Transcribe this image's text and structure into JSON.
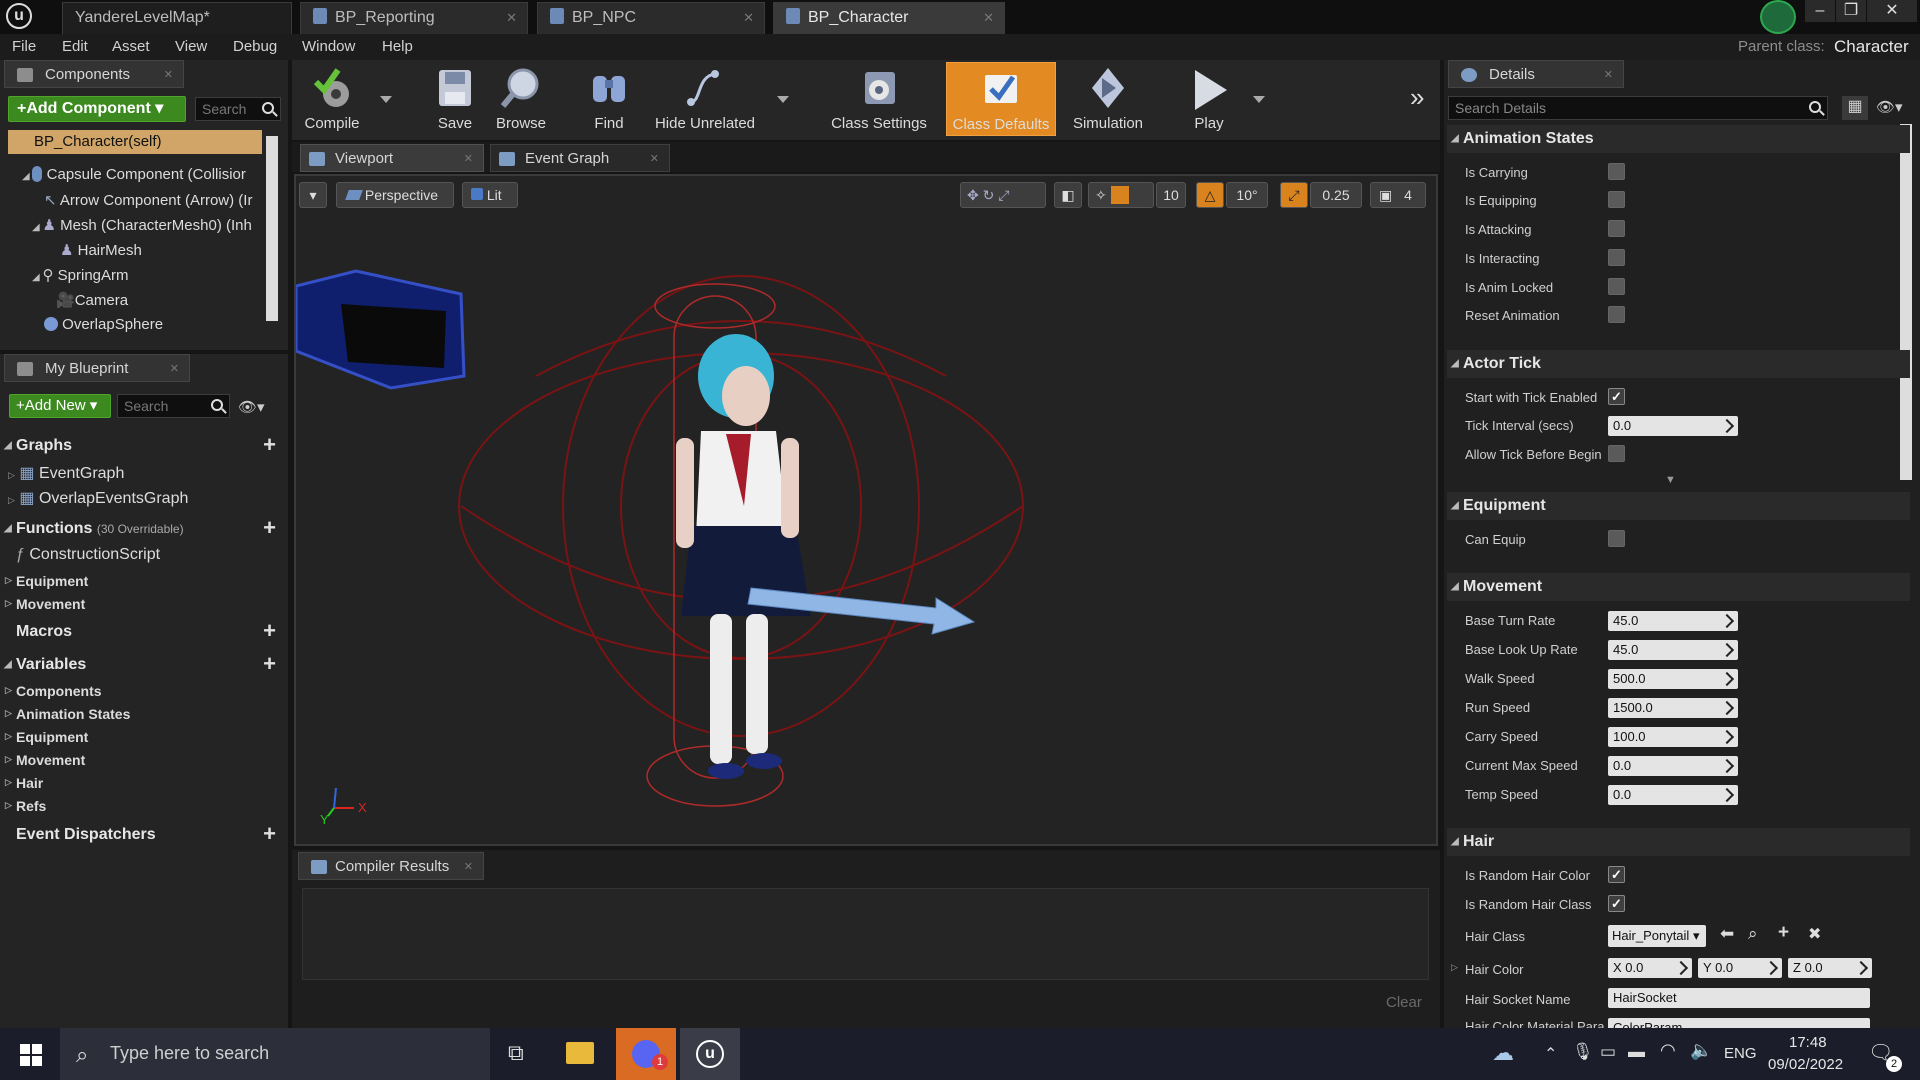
{
  "tabs": [
    {
      "label": "YandereLevelMap*"
    },
    {
      "label": "BP_Reporting"
    },
    {
      "label": "BP_NPC"
    },
    {
      "label": "BP_Character"
    }
  ],
  "menu": [
    "File",
    "Edit",
    "Asset",
    "View",
    "Debug",
    "Window",
    "Help"
  ],
  "parent_class": {
    "label": "Parent class:",
    "value": "Character"
  },
  "components_panel": {
    "title": "Components",
    "add_component": "Add Component",
    "search_placeholder": "Search",
    "self_item": "BP_Character(self)",
    "tree": [
      "Capsule Component (Collisior",
      "Arrow Component (Arrow) (Ir",
      "Mesh (CharacterMesh0) (Inh",
      "HairMesh",
      "SpringArm",
      "Camera",
      "OverlapSphere"
    ]
  },
  "my_blueprint": {
    "title": "My Blueprint",
    "add_new": "Add New",
    "search_placeholder": "Search",
    "graphs_header": "Graphs",
    "graphs": [
      "EventGraph",
      "OverlapEventsGraph"
    ],
    "functions_header": "Functions",
    "functions_note": "(30 Overridable)",
    "functions": [
      "ConstructionScript"
    ],
    "function_categories": [
      "Equipment",
      "Movement"
    ],
    "macros_header": "Macros",
    "variables_header": "Variables",
    "variable_categories": [
      "Components",
      "Animation States",
      "Equipment",
      "Movement",
      "Hair",
      "Refs"
    ],
    "event_dispatchers_header": "Event Dispatchers"
  },
  "toolbar": {
    "compile": "Compile",
    "save": "Save",
    "browse": "Browse",
    "find": "Find",
    "hide_unrelated": "Hide Unrelated",
    "class_settings": "Class Settings",
    "class_defaults": "Class Defaults",
    "simulation": "Simulation",
    "play": "Play"
  },
  "viewport": {
    "tab_viewport": "Viewport",
    "tab_event_graph": "Event Graph",
    "perspective": "Perspective",
    "lit": "Lit",
    "grid_snap": "10",
    "rotation_snap": "10°",
    "scale_snap": "0.25",
    "camera_speed": "4",
    "axis_x": "X",
    "axis_y": "Y"
  },
  "compiler": {
    "title": "Compiler Results",
    "clear": "Clear"
  },
  "details": {
    "title": "Details",
    "search_placeholder": "Search Details",
    "animation_states": {
      "header": "Animation States",
      "items": [
        {
          "label": "Is Carrying",
          "checked": false
        },
        {
          "label": "Is Equipping",
          "checked": false
        },
        {
          "label": "Is Attacking",
          "checked": false
        },
        {
          "label": "Is Interacting",
          "checked": false
        },
        {
          "label": "Is Anim Locked",
          "checked": false
        },
        {
          "label": "Reset Animation",
          "checked": false
        }
      ]
    },
    "actor_tick": {
      "header": "Actor Tick",
      "start_tick_label": "Start with Tick Enabled",
      "tick_interval_label": "Tick Interval (secs)",
      "tick_interval_value": "0.0",
      "allow_tick_label": "Allow Tick Before Begin"
    },
    "equipment": {
      "header": "Equipment",
      "can_equip_label": "Can Equip"
    },
    "movement": {
      "header": "Movement",
      "items": [
        {
          "label": "Base Turn Rate",
          "value": "45.0"
        },
        {
          "label": "Base Look Up Rate",
          "value": "45.0"
        },
        {
          "label": "Walk Speed",
          "value": "500.0"
        },
        {
          "label": "Run Speed",
          "value": "1500.0"
        },
        {
          "label": "Carry Speed",
          "value": "100.0"
        },
        {
          "label": "Current Max Speed",
          "value": "0.0"
        },
        {
          "label": "Temp Speed",
          "value": "0.0"
        }
      ]
    },
    "hair": {
      "header": "Hair",
      "random_color_label": "Is Random Hair Color",
      "random_class_label": "Is Random Hair Class",
      "hair_class_label": "Hair Class",
      "hair_class_value": "Hair_Ponytail",
      "hair_color_label": "Hair Color",
      "hair_color": {
        "x_label": "X",
        "x": "0.0",
        "y_label": "Y",
        "y": "0.0",
        "z_label": "Z",
        "z": "0.0"
      },
      "socket_label": "Hair Socket Name",
      "socket_value": "HairSocket",
      "param_label": "Hair Color Material Para",
      "param_value": "ColorParam"
    }
  },
  "taskbar": {
    "search_placeholder": "Type here to search",
    "lang": "ENG",
    "time": "17:48",
    "date": "09/02/2022",
    "notification_count": "2",
    "discord_badge": "1"
  },
  "colors": {
    "accent_orange": "#e38a22",
    "add_green": "#3c8a1f",
    "panel_bg": "#242424"
  }
}
